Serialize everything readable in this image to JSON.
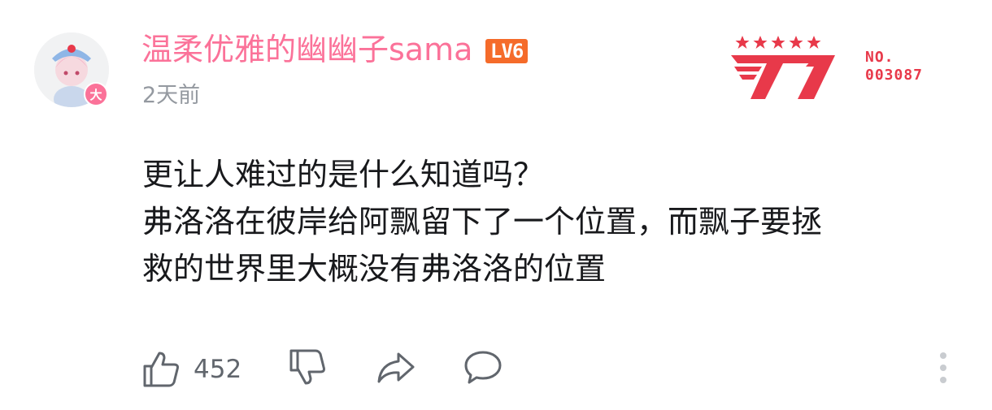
{
  "comment": {
    "author": {
      "name": "温柔优雅的幽幽子sama",
      "level": "LV6",
      "avatar_badge": "大"
    },
    "time": "2天前",
    "content_lines": [
      "更让人难过的是什么知道吗？",
      "弗洛洛在彼岸给阿飘留下了一个位置，而飘子要拯",
      "救的世界里大概没有弗洛洛的位置"
    ],
    "fan_badge": {
      "label": "NO.",
      "number": "003087"
    },
    "actions": {
      "like_count": "452"
    }
  },
  "colors": {
    "username": "#fb7299",
    "level_badge": "#f56b2a",
    "fan_badge_red": "#e8394a",
    "icon_gray": "#61666d"
  },
  "icons": [
    "thumbs-up-icon",
    "thumbs-down-icon",
    "share-icon",
    "reply-icon",
    "more-vertical-icon"
  ]
}
